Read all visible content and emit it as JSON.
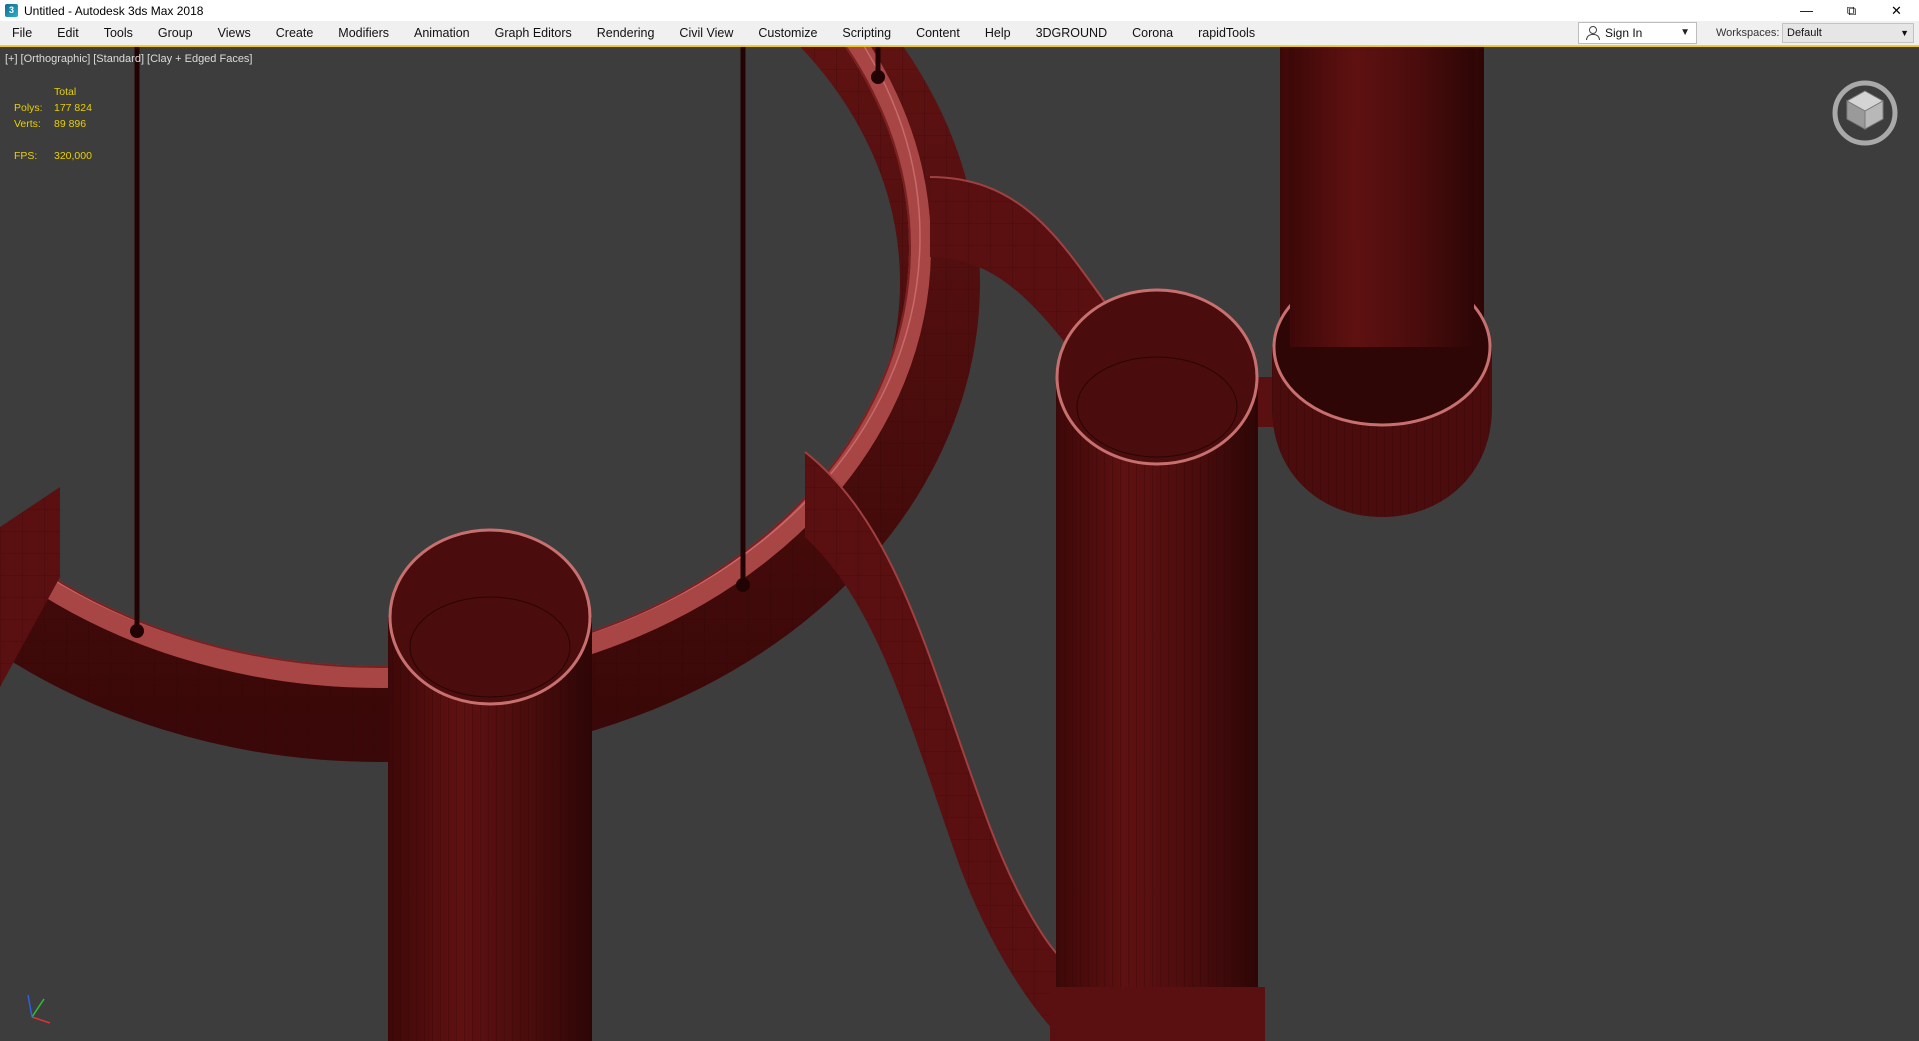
{
  "window": {
    "title": "Untitled - Autodesk 3ds Max 2018",
    "controls": [
      "minimize-icon",
      "restore-icon",
      "close-icon"
    ]
  },
  "menu": {
    "items": [
      "File",
      "Edit",
      "Tools",
      "Group",
      "Views",
      "Create",
      "Modifiers",
      "Animation",
      "Graph Editors",
      "Rendering",
      "Civil View",
      "Customize",
      "Scripting",
      "Content",
      "Help",
      "3DGROUND",
      "Corona",
      "rapidTools"
    ],
    "sign_in": "Sign In",
    "workspaces_label": "Workspaces:",
    "workspace_value": "Default"
  },
  "viewport": {
    "label_plus": "[+]",
    "label_view": "[Orthographic]",
    "label_shading": "[Standard]",
    "label_style": "[Clay + Edged Faces]",
    "stats": {
      "header": "Total",
      "polys_label": "Polys:",
      "polys_value": "177 824",
      "verts_label": "Verts:",
      "verts_value": "89 896",
      "fps_label": "FPS:",
      "fps_value": "320,000"
    },
    "colors": {
      "background": "#3d3d3d",
      "stats_text": "#e8d000",
      "model_fill": "#6b1414",
      "model_edge": "#b05050",
      "active_border": "#f0c419"
    }
  }
}
